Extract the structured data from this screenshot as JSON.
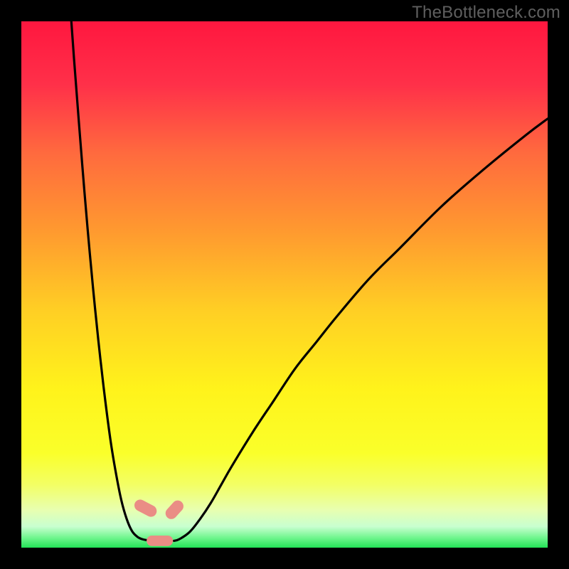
{
  "watermark": "TheBottleneck.com",
  "chart_data": {
    "type": "line",
    "title": "",
    "xlabel": "",
    "ylabel": "",
    "xlim": [
      0,
      100
    ],
    "ylim": [
      0,
      100
    ],
    "series": [
      {
        "name": "left-curve",
        "x": [
          9.5,
          10,
          11,
          12,
          13,
          14,
          15,
          16,
          17,
          18,
          19,
          20,
          21,
          22,
          23,
          24,
          24.5
        ],
        "values": [
          100,
          93,
          80,
          67.5,
          56,
          45.5,
          36,
          27.5,
          20,
          14,
          9,
          5.5,
          3.2,
          2.1,
          1.6,
          1.4,
          1.3
        ]
      },
      {
        "name": "right-curve",
        "x": [
          29,
          30,
          32,
          34,
          36,
          38,
          40,
          44,
          48,
          52,
          56,
          60,
          66,
          72,
          80,
          88,
          96,
          100
        ],
        "values": [
          1.3,
          1.6,
          3.0,
          5.5,
          8.5,
          12,
          15.5,
          22,
          28,
          34,
          39,
          44,
          51,
          57,
          65,
          72,
          78.5,
          81.5
        ]
      }
    ],
    "markers": [
      {
        "name": "marker-left",
        "x": 23.6,
        "y": 7.5,
        "w": 2.2,
        "h": 4.5,
        "angle": -62
      },
      {
        "name": "marker-top-right",
        "x": 29.1,
        "y": 7.2,
        "w": 2.2,
        "h": 4.0,
        "angle": 42
      },
      {
        "name": "marker-bottom",
        "x": 26.3,
        "y": 1.3,
        "w": 5.0,
        "h": 2.0,
        "angle": 0
      }
    ],
    "gradient_stops": [
      {
        "offset": 0.0,
        "color": "#ff173f"
      },
      {
        "offset": 0.12,
        "color": "#ff3049"
      },
      {
        "offset": 0.25,
        "color": "#ff6a3e"
      },
      {
        "offset": 0.4,
        "color": "#ff9a2f"
      },
      {
        "offset": 0.55,
        "color": "#ffcf24"
      },
      {
        "offset": 0.7,
        "color": "#fff31b"
      },
      {
        "offset": 0.82,
        "color": "#faff2a"
      },
      {
        "offset": 0.88,
        "color": "#f3ff64"
      },
      {
        "offset": 0.928,
        "color": "#e8ffb0"
      },
      {
        "offset": 0.96,
        "color": "#c8ffd0"
      },
      {
        "offset": 0.982,
        "color": "#6cf58b"
      },
      {
        "offset": 1.0,
        "color": "#23e257"
      }
    ],
    "marker_color": "#ea8d85",
    "curve_color": "#000000"
  }
}
